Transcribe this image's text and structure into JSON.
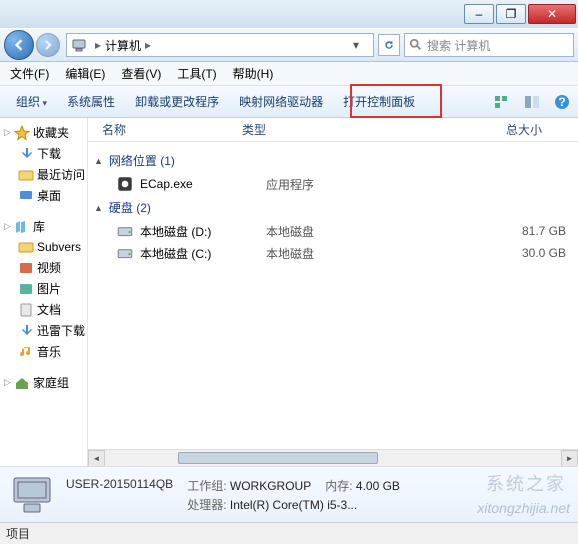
{
  "title_buttons": {
    "min": "–",
    "max": "❐",
    "close": "✕"
  },
  "breadcrumb": {
    "root_icon": "computer",
    "segment": "计算机",
    "sep": "▸"
  },
  "search": {
    "placeholder": "搜索 计算机",
    "icon": "search"
  },
  "menu": [
    {
      "label": "文件(F)",
      "name": "menu-file"
    },
    {
      "label": "编辑(E)",
      "name": "menu-edit"
    },
    {
      "label": "查看(V)",
      "name": "menu-view"
    },
    {
      "label": "工具(T)",
      "name": "menu-tools"
    },
    {
      "label": "帮助(H)",
      "name": "menu-help"
    }
  ],
  "toolbar": {
    "organize": "组织",
    "props": "系统属性",
    "uninstall": "卸载或更改程序",
    "netdrive": "映射网络驱动器",
    "controlpanel": "打开控制面板"
  },
  "sidebar": {
    "fav_header": "收藏夹",
    "fav": [
      {
        "label": "下载",
        "name": "sidebar-item-downloads",
        "icon": "dl"
      },
      {
        "label": "最近访问",
        "name": "sidebar-item-recent",
        "icon": "folder"
      },
      {
        "label": "桌面",
        "name": "sidebar-item-desktop",
        "icon": "monitor"
      }
    ],
    "lib_header": "库",
    "lib": [
      {
        "label": "Subvers",
        "name": "sidebar-item-subversion",
        "icon": "folder"
      },
      {
        "label": "视频",
        "name": "sidebar-item-videos",
        "icon": "video"
      },
      {
        "label": "图片",
        "name": "sidebar-item-pictures",
        "icon": "pic"
      },
      {
        "label": "文档",
        "name": "sidebar-item-documents",
        "icon": "doc"
      },
      {
        "label": "迅雷下载",
        "name": "sidebar-item-xunlei",
        "icon": "dl"
      },
      {
        "label": "音乐",
        "name": "sidebar-item-music",
        "icon": "music"
      }
    ],
    "homegroup": "家庭组"
  },
  "columns": {
    "name": "名称",
    "type": "类型",
    "size": "总大小"
  },
  "groups": [
    {
      "title": "网络位置 (1)",
      "items": [
        {
          "icon": "app",
          "name": "ECap.exe",
          "type": "应用程序",
          "size": ""
        }
      ]
    },
    {
      "title": "硬盘 (2)",
      "items": [
        {
          "icon": "drive",
          "name": "本地磁盘 (D:)",
          "type": "本地磁盘",
          "size": "81.7 GB"
        },
        {
          "icon": "drive",
          "name": "本地磁盘 (C:)",
          "type": "本地磁盘",
          "size": "30.0 GB"
        }
      ]
    }
  ],
  "details": {
    "computer_name": "USER-20150114QB",
    "workgroup_label": "工作组:",
    "workgroup": "WORKGROUP",
    "mem_label": "内存:",
    "mem": "4.00 GB",
    "cpu_label": "处理器:",
    "cpu": "Intel(R) Core(TM) i5-3..."
  },
  "status": {
    "label": "项目"
  },
  "watermark": {
    "a": "系统之家",
    "b": "xitongzhijia.net"
  }
}
